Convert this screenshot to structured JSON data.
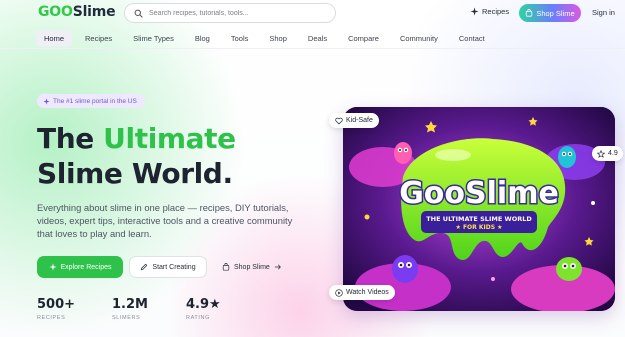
{
  "brand": {
    "logo_goo": "GOO",
    "logo_rest": "Slime"
  },
  "search": {
    "placeholder": "Search recipes, tutorials, tools..."
  },
  "header": {
    "recipes_label": "Recipes",
    "shop_label": "Shop Slime",
    "signin_label": "Sign in"
  },
  "nav": {
    "items": [
      {
        "label": "Home",
        "active": true
      },
      {
        "label": "Recipes"
      },
      {
        "label": "Slime Types"
      },
      {
        "label": "Blog"
      },
      {
        "label": "Tools"
      },
      {
        "label": "Shop"
      },
      {
        "label": "Deals"
      },
      {
        "label": "Compare"
      },
      {
        "label": "Community"
      },
      {
        "label": "Contact"
      }
    ]
  },
  "hero": {
    "badge": "The #1 slime portal in the US",
    "headline_1": "The ",
    "headline_green": "Ultimate",
    "headline_2": "Slime World.",
    "subtext": "Everything about slime in one place — recipes, DIY tutorials, videos, expert tips, interactive tools and a creative community that loves to play and learn.",
    "btn_explore": "Explore Recipes",
    "btn_start": "Start Creating",
    "btn_shop": "Shop Slime",
    "stats": [
      {
        "value": "500+",
        "label": "RECIPES"
      },
      {
        "value": "1.2M",
        "label": "SLIMERS"
      },
      {
        "value": "4.9★",
        "label": "RATING"
      }
    ]
  },
  "image_card": {
    "chip_kid_safe": "Kid-Safe",
    "chip_rating": "4.9",
    "chip_watch": "Watch Videos",
    "art_title": "GooSlime",
    "art_sub1": "THE ULTIMATE SLIME WORLD",
    "art_sub2": "★ FOR KIDS ★"
  },
  "colors": {
    "accent_green": "#2fc24b",
    "badge_purple": "#6b5acb",
    "shop_gradient": [
      "#2fd3a0",
      "#6c7cff",
      "#d95be0"
    ]
  }
}
